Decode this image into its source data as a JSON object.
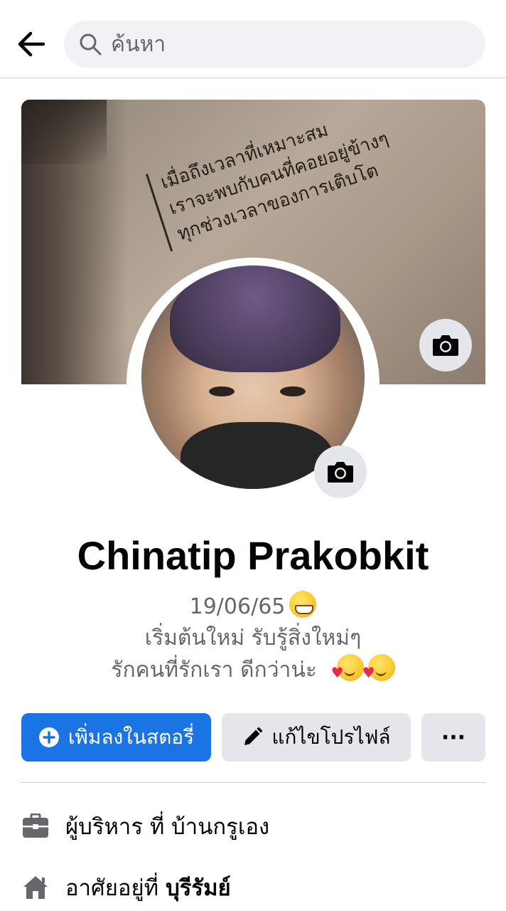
{
  "search": {
    "placeholder": "ค้นหา"
  },
  "cover": {
    "quote_lines": [
      "เมื่อถึงเวลาที่เหมาะสม",
      "เราจะพบกับคนที่คอยอยู่ข้างๆ",
      "ทุกช่วงเวลาของการเติบโต"
    ]
  },
  "profile": {
    "name": "Chinatip Prakobkit",
    "bio_line1": "19/06/65",
    "bio_line2": "เริ่มต้นใหม่  รับรู้สิ่งใหม่ๆ",
    "bio_line3": "รักคนที่รักเรา  ดีกว่าน่ะ"
  },
  "actions": {
    "add_story": "เพิ่มลงในสตอรี่",
    "edit_profile": "แก้ไขโปรไฟล์",
    "more": "···"
  },
  "info": {
    "work": "ผู้บริหาร ที่ บ้านกรูเอง",
    "lives_prefix": "อาศัยอยู่ที่",
    "lives_place": "บุรีรัมย์"
  },
  "colors": {
    "accent": "#1b74e4",
    "secondary_button": "#e4e6eb",
    "muted_text": "#65676b"
  },
  "icons": [
    "back-arrow-icon",
    "search-icon",
    "camera-icon",
    "plus-circle-icon",
    "pencil-icon",
    "briefcase-icon",
    "home-icon"
  ]
}
